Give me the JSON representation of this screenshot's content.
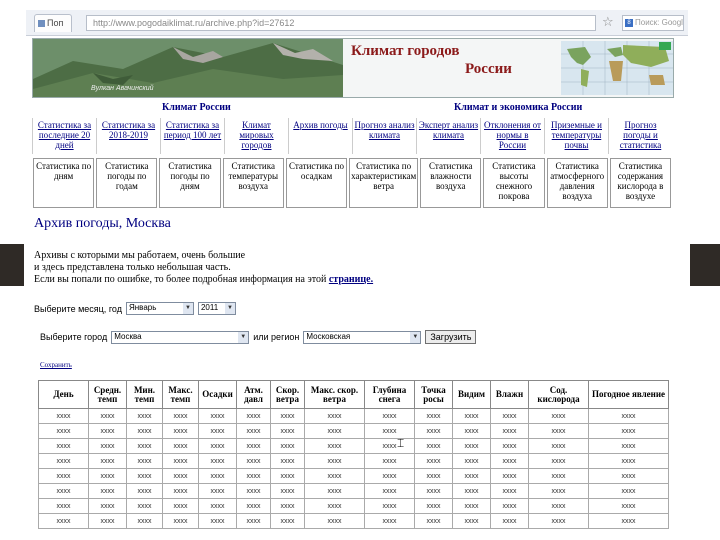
{
  "browser": {
    "tab_title": "Поп",
    "url": "http://www.pogodaiklimat.ru/archive.php?id=27612",
    "search_placeholder": "Поиск: Google"
  },
  "banner": {
    "title": "Климат городов",
    "subtitle": "России",
    "mountain_label": "Вулкан Авачинский"
  },
  "nav": {
    "left_heading": "Климат России",
    "right_heading": "Климат и экономика России",
    "row1": [
      "Статистика за последние 20 дней",
      "Статистика за 2018-2019",
      "Статистика за период 100 лет",
      "Климат мировых городов",
      "Архив погоды",
      "Прогноз анализ климата",
      "Эксперт анализ климата",
      "Отклонения от нормы в России",
      "Приземные и температуры почвы",
      "Прогноз погоды и статистика"
    ],
    "row2": [
      "Статистика по дням",
      "Статистика погоды по годам",
      "Статистика погоды по дням",
      "Статистика температуры воздуха",
      "Статистика по осадкам",
      "Статистика по характеристикам ветра",
      "Статистика влажности воздуха",
      "Статистика высоты снежного покрова",
      "Статистика атмосферного давления воздуха",
      "Статистика содержания кислорода в воздухе"
    ]
  },
  "page": {
    "heading": "Архив погоды, Москва",
    "intro_line1": "Архивы с которыми мы работаем, очень большие",
    "intro_line2": "и здесь представлена только небольшая часть.",
    "intro_line3": "Если вы попали по ошибке, то более подробная информация на этой",
    "intro_link": "странице.",
    "month_label": "Выберите месяц, год",
    "month_value": "Январь",
    "year_value": "2011",
    "city_label": "Выберите город",
    "city_value": "Москва",
    "region_label": "или регион",
    "region_value": "Московская",
    "submit_label": "Загрузить",
    "save_link": "Сохранить"
  },
  "table": {
    "headers": [
      "День",
      "Средн. темп",
      "Мин. темп",
      "Макс. темп",
      "Осадки",
      "Атм. давл",
      "Скор. ветра",
      "Макс. скор. ветра",
      "Глубина снега",
      "Точка росы",
      "Видим",
      "Влажн",
      "Сод. кислорода",
      "Погодное явление"
    ],
    "placeholder": "xxxx",
    "row_count": 8
  }
}
